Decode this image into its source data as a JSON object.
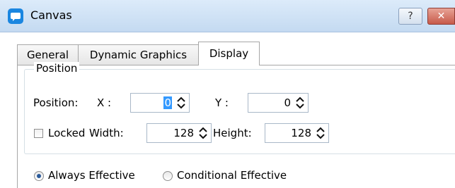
{
  "window": {
    "title": "Canvas",
    "help_label": "?",
    "close_label": "✕"
  },
  "tabs": [
    {
      "label": "General",
      "active": false
    },
    {
      "label": "Dynamic Graphics",
      "active": false
    },
    {
      "label": "Display",
      "active": true
    }
  ],
  "position_group": {
    "legend": "Position",
    "position_label": "Position:",
    "x_label": "X :",
    "x_value": "0",
    "y_label": "Y :",
    "y_value": "0",
    "locked_label": "Locked",
    "locked_checked": false,
    "width_label": "Width:",
    "width_value": "128",
    "height_label": "Height:",
    "height_value": "128"
  },
  "effect": {
    "always_label": "Always Effective",
    "conditional_label": "Conditional Effective",
    "selected": "always"
  },
  "icons": {
    "app": "canvas-app-icon",
    "spin": "up-down-arrows-icon"
  },
  "colors": {
    "titlebar": "#c4daf1",
    "close": "#c75a4a",
    "selection": "#3399ff",
    "radio_dot": "#2a5a9a"
  }
}
